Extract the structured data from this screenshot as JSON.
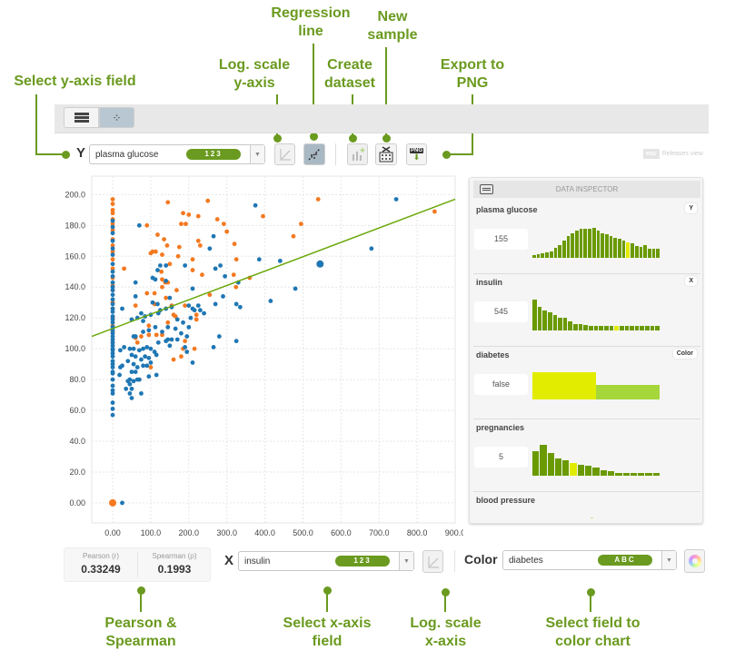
{
  "annotations": {
    "regression": "Regression line",
    "new_sample": "New sample",
    "log_y": "Log. scale y-axis",
    "create_dataset": "Create dataset",
    "export_png": "Export to PNG",
    "select_y": "Select y-axis field",
    "pearson_spearman": "Pearson & Spearman",
    "select_x": "Select x-axis field",
    "log_x": "Log. scale x-axis",
    "color_field": "Select field to color chart"
  },
  "toolbar": {
    "y_label": "Y",
    "y_field": "plasma glucose",
    "y_type": "123",
    "png_label": "PNG",
    "esc_label": "esc",
    "releases": "Releases view"
  },
  "bottom": {
    "pearson_label": "Pearson (r)",
    "pearson_value": "0.33249",
    "spearman_label": "Spearman (ρ)",
    "spearman_value": "0.1993",
    "x_label": "X",
    "x_field": "insulin",
    "x_type": "123",
    "color_label": "Color",
    "color_field": "diabetes",
    "color_type": "ABC"
  },
  "colors": {
    "accent": "#6a9a1f",
    "true": "#f47920",
    "false": "#1f77b4",
    "regression": "#6aa80a",
    "bar_dark": "#6a9a00",
    "bar_light": "#a5d63a",
    "bar_selected": "#e2ec00"
  },
  "inspector": {
    "title": "DATA INSPECTOR",
    "fields": [
      {
        "name": "plasma glucose",
        "tag": "Y",
        "value": "155",
        "hist": [
          0.1,
          0.13,
          0.15,
          0.17,
          0.22,
          0.32,
          0.42,
          0.57,
          0.7,
          0.8,
          0.88,
          0.95,
          0.95,
          0.94,
          0.96,
          0.88,
          0.8,
          0.76,
          0.71,
          0.66,
          0.62,
          0.57,
          0.5,
          0.47,
          0.37,
          0.36,
          0.4,
          0.3,
          0.3,
          0.3
        ],
        "selected": 22
      },
      {
        "name": "insulin",
        "tag": "X",
        "value": "545",
        "hist": [
          1,
          0.76,
          0.66,
          0.58,
          0.5,
          0.4,
          0.4,
          0.28,
          0.2,
          0.2,
          0.17,
          0.15,
          0.15,
          0.15,
          0.15,
          0.15,
          0.15,
          0.15,
          0.15,
          0.15,
          0.15,
          0.15,
          0.15,
          0.15,
          0.15
        ],
        "selected": 16
      },
      {
        "name": "diabetes",
        "tag": "Color",
        "value": "false",
        "hist": [
          1,
          0.52
        ],
        "selected": 0
      },
      {
        "name": "pregnancies",
        "tag": "",
        "value": "5",
        "hist": [
          0.78,
          1,
          0.75,
          0.55,
          0.5,
          0.4,
          0.35,
          0.32,
          0.26,
          0.18,
          0.15,
          0.1,
          0.1,
          0.1,
          0.1,
          0.1,
          0.1
        ],
        "selected": 5
      },
      {
        "name": "blood pressure",
        "tag": "",
        "value": "",
        "hist": [],
        "selected": -1
      }
    ]
  },
  "chart_data": {
    "type": "scatter",
    "xlabel": "insulin",
    "ylabel": "plasma glucose",
    "xlim": [
      -55,
      900
    ],
    "ylim": [
      -13,
      212
    ],
    "x_ticks": [
      "0.00",
      "100.0",
      "200.0",
      "300.0",
      "400.0",
      "500.0",
      "600.0",
      "700.0",
      "800.0",
      "900.0"
    ],
    "y_ticks": [
      "0.00",
      "20.0",
      "40.0",
      "60.0",
      "80.0",
      "100.0",
      "120.0",
      "140.0",
      "160.0",
      "180.0",
      "200.0"
    ],
    "grid": true,
    "regression_line": [
      [
        -55,
        108
      ],
      [
        900,
        197
      ]
    ],
    "selected_point": [
      545,
      155
    ],
    "series": [
      {
        "class": "true",
        "points": [
          [
            0,
            0
          ],
          [
            30,
            152
          ],
          [
            90,
            180
          ],
          [
            145,
            195
          ],
          [
            250,
            196
          ],
          [
            185,
            188
          ],
          [
            200,
            187
          ],
          [
            225,
            186
          ],
          [
            275,
            184
          ],
          [
            292,
            181
          ],
          [
            180,
            181
          ],
          [
            192,
            181
          ],
          [
            475,
            173
          ],
          [
            395,
            186
          ],
          [
            540,
            197
          ],
          [
            495,
            181
          ],
          [
            300,
            176
          ],
          [
            320,
            168
          ],
          [
            325,
            158
          ],
          [
            235,
            148
          ],
          [
            210,
            151
          ],
          [
            210,
            158
          ],
          [
            118,
            174
          ],
          [
            135,
            171
          ],
          [
            143,
            167
          ],
          [
            175,
            166
          ],
          [
            230,
            167
          ],
          [
            225,
            170
          ],
          [
            100,
            162
          ],
          [
            105,
            163
          ],
          [
            113,
            163
          ],
          [
            172,
            160
          ],
          [
            130,
            161
          ],
          [
            128,
            150
          ],
          [
            150,
            155
          ],
          [
            130,
            145
          ],
          [
            138,
            143
          ],
          [
            145,
            143
          ],
          [
            90,
            136
          ],
          [
            110,
            136
          ],
          [
            168,
            138
          ],
          [
            130,
            140
          ],
          [
            140,
            133
          ],
          [
            60,
            128
          ],
          [
            110,
            129
          ],
          [
            190,
            128
          ],
          [
            155,
            128
          ],
          [
            160,
            122
          ],
          [
            165,
            121
          ],
          [
            220,
            122
          ],
          [
            220,
            119
          ],
          [
            145,
            117
          ],
          [
            95,
            115
          ],
          [
            95,
            109
          ],
          [
            75,
            108
          ],
          [
            60,
            107
          ],
          [
            65,
            104
          ],
          [
            115,
            109
          ],
          [
            130,
            109
          ],
          [
            190,
            105
          ],
          [
            185,
            100
          ],
          [
            215,
            100
          ],
          [
            160,
            93
          ],
          [
            180,
            95
          ],
          [
            100,
            88
          ],
          [
            70,
            80
          ],
          [
            255,
            135
          ],
          [
            318,
            148
          ],
          [
            324,
            140
          ],
          [
            360,
            146
          ],
          [
            846,
            189
          ],
          [
            0,
            104
          ],
          [
            0,
            111
          ],
          [
            0,
            115
          ],
          [
            0,
            120
          ],
          [
            0,
            126
          ],
          [
            0,
            130
          ],
          [
            0,
            138
          ],
          [
            0,
            141
          ],
          [
            0,
            146
          ],
          [
            0,
            152
          ],
          [
            0,
            158
          ],
          [
            0,
            163
          ],
          [
            0,
            167
          ],
          [
            0,
            171
          ],
          [
            0,
            177
          ],
          [
            0,
            181
          ],
          [
            0,
            184
          ],
          [
            0,
            188
          ],
          [
            0,
            190
          ],
          [
            0,
            194
          ],
          [
            0,
            197
          ]
        ]
      },
      {
        "class": "false",
        "points": [
          [
            70,
            180
          ],
          [
            375,
            193
          ],
          [
            745,
            197
          ],
          [
            680,
            165
          ],
          [
            545,
            155
          ],
          [
            265,
            173
          ],
          [
            255,
            165
          ],
          [
            385,
            158
          ],
          [
            440,
            157
          ],
          [
            283,
            154
          ],
          [
            270,
            152
          ],
          [
            190,
            154
          ],
          [
            125,
            154
          ],
          [
            140,
            154
          ],
          [
            118,
            151
          ],
          [
            105,
            146
          ],
          [
            112,
            145
          ],
          [
            60,
            143
          ],
          [
            295,
            147
          ],
          [
            140,
            144
          ],
          [
            480,
            139
          ],
          [
            330,
            143
          ],
          [
            335,
            127
          ],
          [
            325,
            129
          ],
          [
            415,
            131
          ],
          [
            290,
            134
          ],
          [
            270,
            129
          ],
          [
            210,
            139
          ],
          [
            60,
            134
          ],
          [
            150,
            133
          ],
          [
            105,
            130
          ],
          [
            118,
            129
          ],
          [
            125,
            125
          ],
          [
            140,
            126
          ],
          [
            155,
            127
          ],
          [
            25,
            126
          ],
          [
            210,
            126
          ],
          [
            225,
            128
          ],
          [
            240,
            123
          ],
          [
            230,
            125
          ],
          [
            200,
            128
          ],
          [
            215,
            125
          ],
          [
            75,
            123
          ],
          [
            85,
            121
          ],
          [
            65,
            120
          ],
          [
            50,
            119
          ],
          [
            80,
            118
          ],
          [
            100,
            122
          ],
          [
            120,
            123
          ],
          [
            170,
            119
          ],
          [
            205,
            120
          ],
          [
            185,
            117
          ],
          [
            200,
            114
          ],
          [
            165,
            113
          ],
          [
            145,
            114
          ],
          [
            130,
            111
          ],
          [
            112,
            114
          ],
          [
            95,
            112
          ],
          [
            80,
            111
          ],
          [
            60,
            108
          ],
          [
            55,
            108
          ],
          [
            120,
            104
          ],
          [
            145,
            106
          ],
          [
            155,
            106
          ],
          [
            170,
            106
          ],
          [
            180,
            110
          ],
          [
            195,
            108
          ],
          [
            140,
            105
          ],
          [
            150,
            102
          ],
          [
            280,
            108
          ],
          [
            325,
            105
          ],
          [
            265,
            101
          ],
          [
            30,
            101
          ],
          [
            45,
            100
          ],
          [
            55,
            100
          ],
          [
            70,
            99
          ],
          [
            80,
            100
          ],
          [
            90,
            101
          ],
          [
            100,
            100
          ],
          [
            110,
            98
          ],
          [
            115,
            96
          ],
          [
            50,
            96
          ],
          [
            60,
            95
          ],
          [
            75,
            93
          ],
          [
            85,
            95
          ],
          [
            95,
            94
          ],
          [
            100,
            91
          ],
          [
            40,
            92
          ],
          [
            55,
            90
          ],
          [
            65,
            88
          ],
          [
            80,
            89
          ],
          [
            90,
            89
          ],
          [
            20,
            88
          ],
          [
            25,
            89
          ],
          [
            60,
            85
          ],
          [
            50,
            85
          ],
          [
            45,
            80
          ],
          [
            55,
            79
          ],
          [
            65,
            80
          ],
          [
            70,
            80
          ],
          [
            95,
            82
          ],
          [
            115,
            83
          ],
          [
            40,
            79
          ],
          [
            45,
            77
          ],
          [
            50,
            74
          ],
          [
            35,
            74
          ],
          [
            45,
            71
          ],
          [
            50,
            68
          ],
          [
            75,
            71
          ],
          [
            210,
            91
          ],
          [
            195,
            98
          ],
          [
            190,
            101
          ],
          [
            20,
            99
          ],
          [
            18,
            83
          ],
          [
            25,
            0
          ],
          [
            0,
            57
          ],
          [
            0,
            61
          ],
          [
            0,
            65
          ],
          [
            0,
            71
          ],
          [
            0,
            73
          ],
          [
            0,
            76
          ],
          [
            0,
            80
          ],
          [
            0,
            84
          ],
          [
            0,
            85
          ],
          [
            0,
            88
          ],
          [
            0,
            90
          ],
          [
            0,
            92
          ],
          [
            0,
            95
          ],
          [
            0,
            97
          ],
          [
            0,
            99
          ],
          [
            0,
            100
          ],
          [
            0,
            102
          ],
          [
            0,
            104
          ],
          [
            0,
            106
          ],
          [
            0,
            108
          ],
          [
            0,
            110
          ],
          [
            0,
            112
          ],
          [
            0,
            114
          ],
          [
            0,
            117
          ],
          [
            0,
            119
          ],
          [
            0,
            121
          ],
          [
            0,
            124
          ],
          [
            0,
            126
          ],
          [
            0,
            129
          ],
          [
            0,
            132
          ],
          [
            0,
            135
          ],
          [
            0,
            138
          ],
          [
            0,
            140
          ],
          [
            0,
            143
          ],
          [
            0,
            147
          ],
          [
            0,
            150
          ],
          [
            0,
            155
          ],
          [
            0,
            161
          ],
          [
            0,
            165
          ],
          [
            0,
            170
          ],
          [
            0,
            175
          ],
          [
            0,
            179
          ],
          [
            0,
            183
          ]
        ]
      }
    ]
  }
}
